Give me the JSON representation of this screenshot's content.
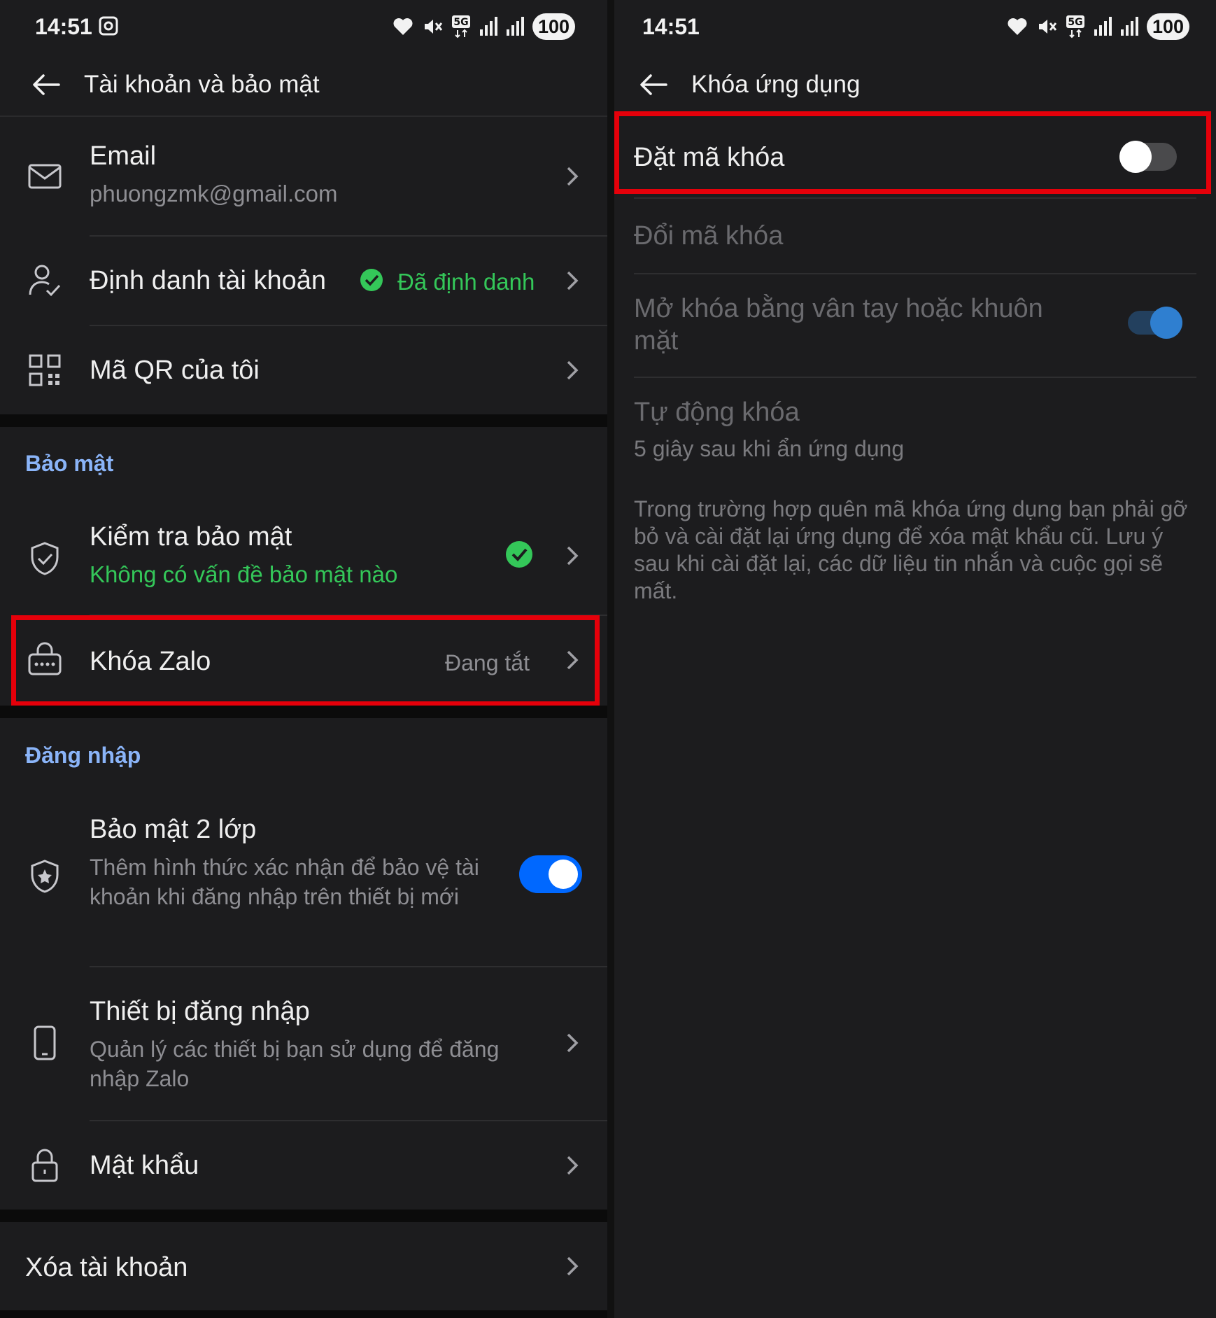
{
  "status_bar": {
    "time": "14:51",
    "battery": "100",
    "network": "5G"
  },
  "left": {
    "title": "Tài khoản và bảo mật",
    "email": {
      "label": "Email",
      "value": "phuongzmk@gmail.com"
    },
    "identity": {
      "label": "Định danh tài khoản",
      "status": "Đã định danh"
    },
    "qr": {
      "label": "Mã QR của tôi"
    },
    "section_security": "Bảo mật",
    "security_check": {
      "label": "Kiểm tra bảo mật",
      "status": "Không có vấn đề bảo mật nào"
    },
    "zalo_lock": {
      "label": "Khóa Zalo",
      "status": "Đang tắt"
    },
    "section_login": "Đăng nhập",
    "two_factor": {
      "label": "Bảo mật 2 lớp",
      "desc": "Thêm hình thức xác nhận để bảo vệ tài khoản khi đăng nhập trên thiết bị mới",
      "enabled": true
    },
    "devices": {
      "label": "Thiết bị đăng nhập",
      "desc": "Quản lý các thiết bị bạn sử dụng để đăng nhập Zalo"
    },
    "password": {
      "label": "Mật khẩu"
    },
    "delete_account": {
      "label": "Xóa tài khoản"
    }
  },
  "right": {
    "title": "Khóa ứng dụng",
    "set_code": {
      "label": "Đặt mã khóa",
      "enabled": false
    },
    "change_code": {
      "label": "Đổi mã khóa"
    },
    "biometric": {
      "label": "Mở khóa bằng vân tay hoặc khuôn mặt",
      "enabled": true
    },
    "auto_lock": {
      "label": "Tự động khóa",
      "value": "5 giây sau khi ẩn ứng dụng"
    },
    "note": "Trong trường hợp quên mã khóa ứng dụng bạn phải gỡ bỏ và cài đặt lại ứng dụng để xóa mật khẩu cũ. Lưu ý sau khi cài đặt lại, các dữ liệu tin nhắn và cuộc gọi sẽ mất."
  },
  "colors": {
    "accent_blue": "#8ab4f8",
    "toggle_on": "#0068ff",
    "success_green": "#34c759",
    "highlight_red": "#e5000a"
  }
}
